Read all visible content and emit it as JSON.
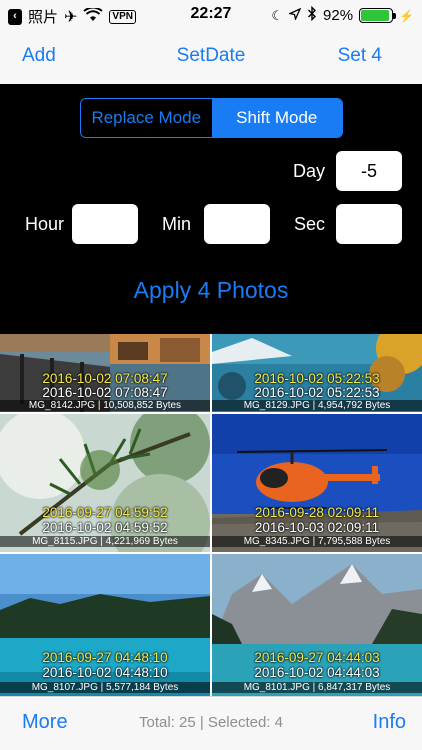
{
  "status_bar": {
    "back_app": "照片",
    "time": "22:27",
    "vpn": "VPN",
    "battery_percent": "92%",
    "battery_level": 0.92
  },
  "nav": {
    "left": "Add",
    "title": "SetDate",
    "right": "Set 4"
  },
  "mode": {
    "options": [
      "Replace Mode",
      "Shift Mode"
    ],
    "selected": "Shift Mode"
  },
  "fields": {
    "day_label": "Day",
    "day_value": "-5",
    "hour_label": "Hour",
    "hour_value": "",
    "min_label": "Min",
    "min_value": "",
    "sec_label": "Sec",
    "sec_value": ""
  },
  "apply_label": "Apply 4 Photos",
  "photos": [
    {
      "new_date": "2016-10-02 07:08:47",
      "old_date": "2016-10-02 07:08:47",
      "info": "MG_8142.JPG | 10,508,852 Bytes",
      "selected": false
    },
    {
      "new_date": "2016-10-02 05:22:53",
      "old_date": "2016-10-02 05:22:53",
      "info": "MG_8129.JPG | 4,954,792 Bytes",
      "selected": false
    },
    {
      "new_date": "2016-09-27 04:59:52",
      "old_date": "2016-10-02 04:59:52",
      "info": "MG_8115.JPG | 4,221,969 Bytes",
      "selected": true
    },
    {
      "new_date": "2016-09-28 02:09:11",
      "old_date": "2016-10-03 02:09:11",
      "info": "MG_8345.JPG | 7,795,588 Bytes",
      "selected": true
    },
    {
      "new_date": "2016-09-27 04:48:10",
      "old_date": "2016-10-02 04:48:10",
      "info": "MG_8107.JPG | 5,577,184 Bytes",
      "selected": true
    },
    {
      "new_date": "2016-09-27 04:44:03",
      "old_date": "2016-10-02 04:44:03",
      "info": "MG_8101.JPG | 6,847,317 Bytes",
      "selected": true
    }
  ],
  "toolbar": {
    "more": "More",
    "status": "Total: 25 | Selected: 4",
    "info": "Info"
  },
  "colors": {
    "accent": "#1a7cf4",
    "selection": "#2cea2c",
    "new_date": "#f5e94a"
  }
}
